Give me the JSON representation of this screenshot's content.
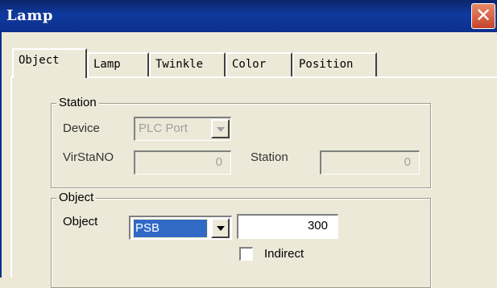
{
  "window": {
    "title": "Lamp",
    "close_glyph": "✕",
    "close_icon": "close-icon"
  },
  "tabs": [
    {
      "label": "Object",
      "active": true
    },
    {
      "label": "Lamp",
      "active": false
    },
    {
      "label": "Twinkle",
      "active": false
    },
    {
      "label": "Color",
      "active": false
    },
    {
      "label": "Position",
      "active": false
    }
  ],
  "station_group": {
    "title": "Station",
    "device_label": "Device",
    "device_value": "PLC Port",
    "virstano_label": "VirStaNO",
    "virstano_value": "0",
    "station_label": "Station",
    "station_value": "0"
  },
  "object_group": {
    "title": "Object",
    "object_label": "Object",
    "object_selected": "PSB",
    "address_value": "300",
    "indirect_label": "Indirect",
    "indirect_checked": false
  }
}
